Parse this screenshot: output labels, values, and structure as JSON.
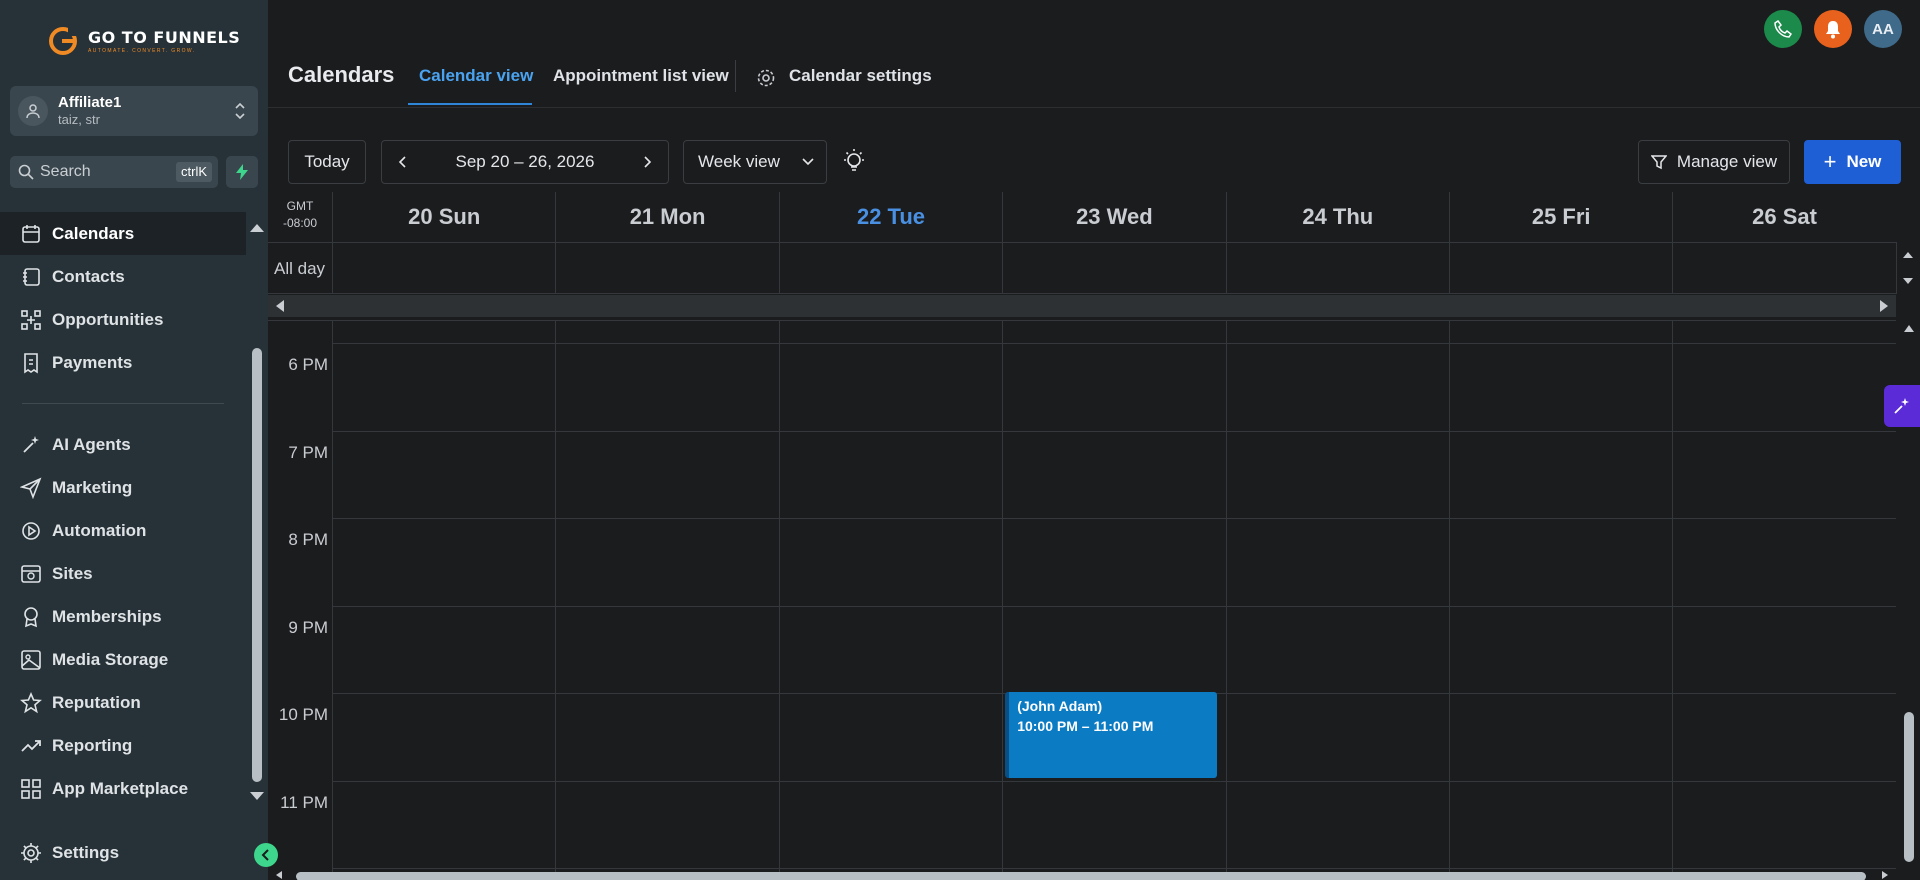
{
  "brand": {
    "name": "GO TO FUNNELS",
    "tagline": "AUTOMATE. CONVERT. GROW."
  },
  "account": {
    "name": "Affiliate1",
    "sub": "taiz, str"
  },
  "search": {
    "placeholder": "Search",
    "shortcut": "ctrlK"
  },
  "nav": {
    "items": [
      {
        "label": "Calendars",
        "icon": "calendar-icon",
        "active": true
      },
      {
        "label": "Contacts",
        "icon": "contacts-icon"
      },
      {
        "label": "Opportunities",
        "icon": "opportunities-icon"
      },
      {
        "label": "Payments",
        "icon": "payments-icon"
      },
      {
        "label": "AI Agents",
        "icon": "ai-sparkle-icon"
      },
      {
        "label": "Marketing",
        "icon": "send-icon"
      },
      {
        "label": "Automation",
        "icon": "automation-icon"
      },
      {
        "label": "Sites",
        "icon": "sites-icon"
      },
      {
        "label": "Memberships",
        "icon": "badge-icon"
      },
      {
        "label": "Media Storage",
        "icon": "image-icon"
      },
      {
        "label": "Reputation",
        "icon": "star-icon"
      },
      {
        "label": "Reporting",
        "icon": "trend-icon"
      },
      {
        "label": "App Marketplace",
        "icon": "grid-icon"
      }
    ],
    "settings": "Settings"
  },
  "header": {
    "title": "Calendars",
    "tabs": [
      {
        "label": "Calendar view",
        "active": true
      },
      {
        "label": "Appointment list view"
      },
      {
        "label": "Calendar settings"
      }
    ],
    "avatar_initials": "AA"
  },
  "toolbar": {
    "today": "Today",
    "range": "Sep 20 – 26, 2026",
    "view": "Week view",
    "manage_view": "Manage view",
    "new": "New"
  },
  "calendar": {
    "tz_line1": "GMT",
    "tz_line2": "-08:00",
    "all_day": "All day",
    "days": [
      {
        "label": "20 Sun"
      },
      {
        "label": "21 Mon"
      },
      {
        "label": "22 Tue",
        "today": true
      },
      {
        "label": "23 Wed"
      },
      {
        "label": "24 Thu"
      },
      {
        "label": "25 Fri"
      },
      {
        "label": "26 Sat"
      }
    ],
    "hours": [
      "6 PM",
      "7 PM",
      "8 PM",
      "9 PM",
      "10 PM",
      "11 PM"
    ],
    "event": {
      "title": "(John Adam)",
      "time": "10:00 PM – 11:00 PM",
      "day_index": 3,
      "color": "#0b7bc4"
    }
  },
  "colors": {
    "accent": "#1f5fd6",
    "today": "#4a90e2",
    "sidebar": "#263238"
  }
}
